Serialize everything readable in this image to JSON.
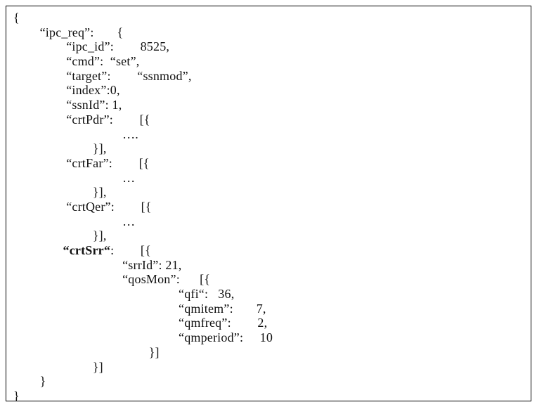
{
  "code": {
    "braceOpen": "{",
    "braceClose": "}",
    "arrObjOpen": "[{",
    "objArrClose": "}]",
    "ellipsis": "…",
    "ellipsisDots": "….",
    "ipc_req_label": "“ipc_req”",
    "ipc_id_label": "“ipc_id”",
    "ipc_id_value": "8525",
    "cmd_label": "“cmd”",
    "cmd_value": "“set”",
    "target_label": "“target”",
    "target_value": "“ssnmod”",
    "index_label": "“index”",
    "index_value": "0",
    "ssnId_label": "“ssnId”",
    "ssnId_value": "1",
    "crtPdr_label": "“crtPdr”",
    "crtFar_label": "“crtFar”",
    "crtQer_label": "“crtQer”",
    "crtSrr_label": "“crtSrr“",
    "srrId_label": "“srrId”",
    "srrId_value": "21",
    "qosMon_label": "“qosMon”",
    "qfi_label": "“qfi“",
    "qfi_value": "36",
    "qmitem_label": "“qmitem”",
    "qmitem_value": "7",
    "qmfreq_label": "“qmfreq”",
    "qmfreq_value": "2",
    "qmperiod_label": "“qmperiod”",
    "qmperiod_value": "10"
  }
}
